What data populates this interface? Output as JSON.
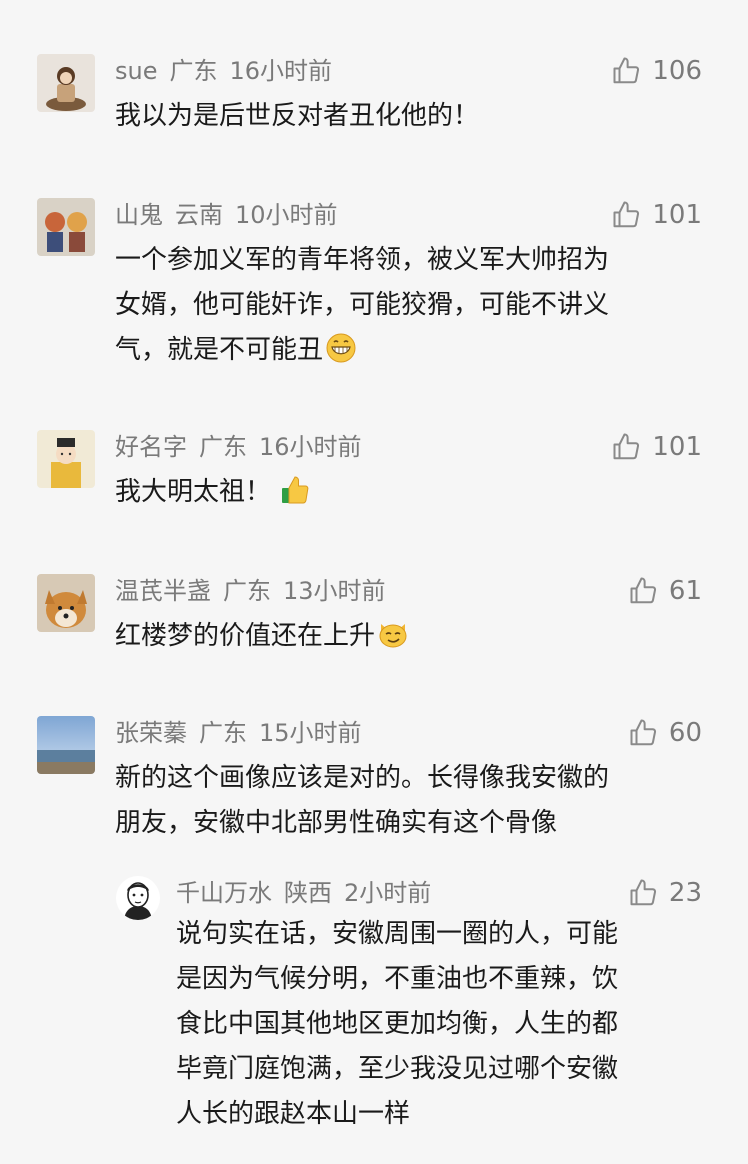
{
  "comments": [
    {
      "user": "sue",
      "region": "广东",
      "time": "16小时前",
      "likes": "106",
      "lines": [
        "我以为是后世反对者丑化他的！"
      ]
    },
    {
      "user": "山鬼",
      "region": "云南",
      "time": "10小时前",
      "likes": "101",
      "lines": [
        "一个参加义军的青年将领，被义军大帅招为",
        "女婿，他可能奸诈，可能狡猾，可能不讲义",
        "气，就是不可能丑"
      ],
      "emoji": "grinning-emoji"
    },
    {
      "user": "好名字",
      "region": "广东",
      "time": "16小时前",
      "likes": "101",
      "lines": [
        "我大明太祖！"
      ],
      "emoji": "thumbs-up-emoji"
    },
    {
      "user": "温芪半盏",
      "region": "广东",
      "time": "13小时前",
      "likes": "61",
      "lines": [
        "红楼梦的价值还在上升"
      ],
      "emoji": "smirking-cat-emoji"
    },
    {
      "user": "张荣蓁",
      "region": "广东",
      "time": "15小时前",
      "likes": "60",
      "lines": [
        "新的这个画像应该是对的。长得像我安徽的",
        "朋友，安徽中北部男性确实有这个骨像"
      ]
    }
  ],
  "reply": {
    "user": "千山万水",
    "region": "陕西",
    "time": "2小时前",
    "likes": "23",
    "lines": [
      "说句实在话，安徽周围一圈的人，可能",
      "是因为气候分明，不重油也不重辣，饮",
      "食比中国其他地区更加均衡，人生的都",
      "毕竟门庭饱满，至少我没见过哪个安徽",
      "人长的跟赵本山一样"
    ]
  },
  "icons": {
    "like": "thumbs-up-outline-icon"
  }
}
